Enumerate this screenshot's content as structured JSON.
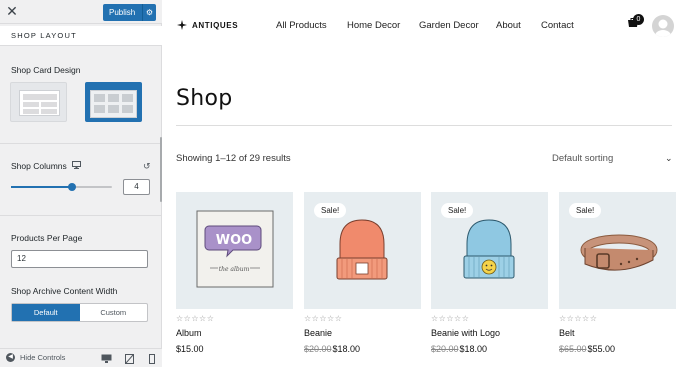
{
  "customizer": {
    "publish_label": "Publish",
    "section_title": "SHOP LAYOUT",
    "shop_card_design_label": "Shop Card Design",
    "shop_columns_label": "Shop Columns",
    "shop_columns_value": "4",
    "shop_columns_slider_fraction": 0.6,
    "products_per_page_label": "Products Per Page",
    "products_per_page_value": "12",
    "archive_width_label": "Shop Archive Content Width",
    "archive_width_options": [
      "Default",
      "Custom"
    ],
    "archive_width_selected": "Default",
    "hide_controls_label": "Hide Controls",
    "accent_color": "#2271b1"
  },
  "store": {
    "logo_text": "ANTIQUES",
    "nav": [
      "All Products",
      "Home Decor",
      "Garden Decor",
      "About",
      "Contact"
    ],
    "cart_count": "0",
    "page_title": "Shop",
    "results_text": "Showing 1–12 of 29 results",
    "sorting_label": "Default sorting",
    "sale_badge": "Sale!",
    "stars": "☆☆☆☆☆",
    "products": [
      {
        "name": "Album",
        "price": "$15.00",
        "old_price": "",
        "sale": false,
        "icon": "woo-album-icon"
      },
      {
        "name": "Beanie",
        "price": "$18.00",
        "old_price": "$20.00",
        "sale": true,
        "icon": "orange-beanie-icon"
      },
      {
        "name": "Beanie with Logo",
        "price": "$18.00",
        "old_price": "$20.00",
        "sale": true,
        "icon": "blue-beanie-icon"
      },
      {
        "name": "Belt",
        "price": "$55.00",
        "old_price": "$65.00",
        "sale": true,
        "icon": "belt-icon"
      }
    ]
  }
}
